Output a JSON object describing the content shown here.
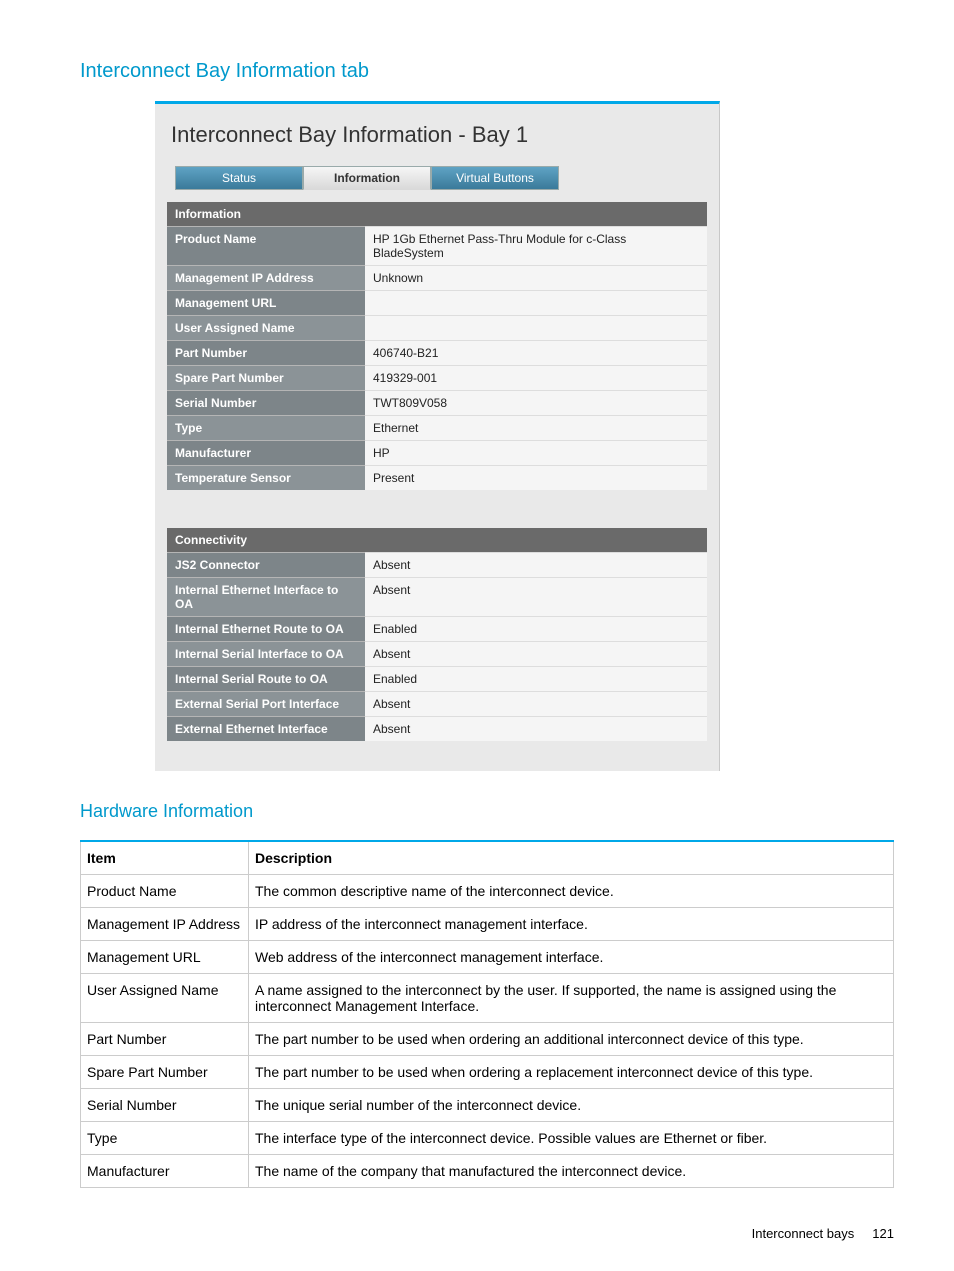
{
  "section_title": "Interconnect Bay Information tab",
  "panel_title": "Interconnect Bay Information - Bay 1",
  "tabs": [
    "Status",
    "Information",
    "Virtual Buttons"
  ],
  "active_tab_index": 1,
  "info": {
    "header": "Information",
    "rows": [
      {
        "label": "Product Name",
        "value": "HP 1Gb Ethernet Pass-Thru Module for c-Class BladeSystem"
      },
      {
        "label": "Management IP Address",
        "value": "Unknown"
      },
      {
        "label": "Management URL",
        "value": ""
      },
      {
        "label": "User Assigned Name",
        "value": ""
      },
      {
        "label": "Part Number",
        "value": "406740-B21"
      },
      {
        "label": "Spare Part Number",
        "value": "419329-001"
      },
      {
        "label": "Serial Number",
        "value": "TWT809V058"
      },
      {
        "label": "Type",
        "value": "Ethernet"
      },
      {
        "label": "Manufacturer",
        "value": "HP"
      },
      {
        "label": "Temperature Sensor",
        "value": "Present"
      }
    ]
  },
  "conn": {
    "header": "Connectivity",
    "rows": [
      {
        "label": "JS2 Connector",
        "value": "Absent"
      },
      {
        "label": "Internal Ethernet Interface to OA",
        "value": "Absent"
      },
      {
        "label": "Internal Ethernet Route to OA",
        "value": "Enabled"
      },
      {
        "label": "Internal Serial Interface to OA",
        "value": "Absent"
      },
      {
        "label": "Internal Serial Route to OA",
        "value": "Enabled"
      },
      {
        "label": "External Serial Port Interface",
        "value": "Absent"
      },
      {
        "label": "External Ethernet Interface",
        "value": "Absent"
      }
    ]
  },
  "sub_section_title": "Hardware Information",
  "desc": {
    "columns": [
      "Item",
      "Description"
    ],
    "rows": [
      {
        "item": "Product Name",
        "description": "The common descriptive name of the interconnect device."
      },
      {
        "item": "Management IP Address",
        "description": "IP address of the interconnect management interface."
      },
      {
        "item": "Management URL",
        "description": "Web address of the interconnect management interface."
      },
      {
        "item": "User Assigned Name",
        "description": "A name assigned to the interconnect by the user. If supported, the name is assigned using the interconnect Management Interface."
      },
      {
        "item": "Part Number",
        "description": "The part number to be used when ordering an additional interconnect device of this type."
      },
      {
        "item": "Spare Part Number",
        "description": "The part number to be used when ordering a replacement interconnect device of this type."
      },
      {
        "item": "Serial Number",
        "description": "The unique serial number of the interconnect device."
      },
      {
        "item": "Type",
        "description": "The interface type of the interconnect device. Possible values are Ethernet or fiber."
      },
      {
        "item": "Manufacturer",
        "description": "The name of the company that manufactured the interconnect device."
      }
    ]
  },
  "footer": {
    "text": "Interconnect bays",
    "page": "121"
  }
}
